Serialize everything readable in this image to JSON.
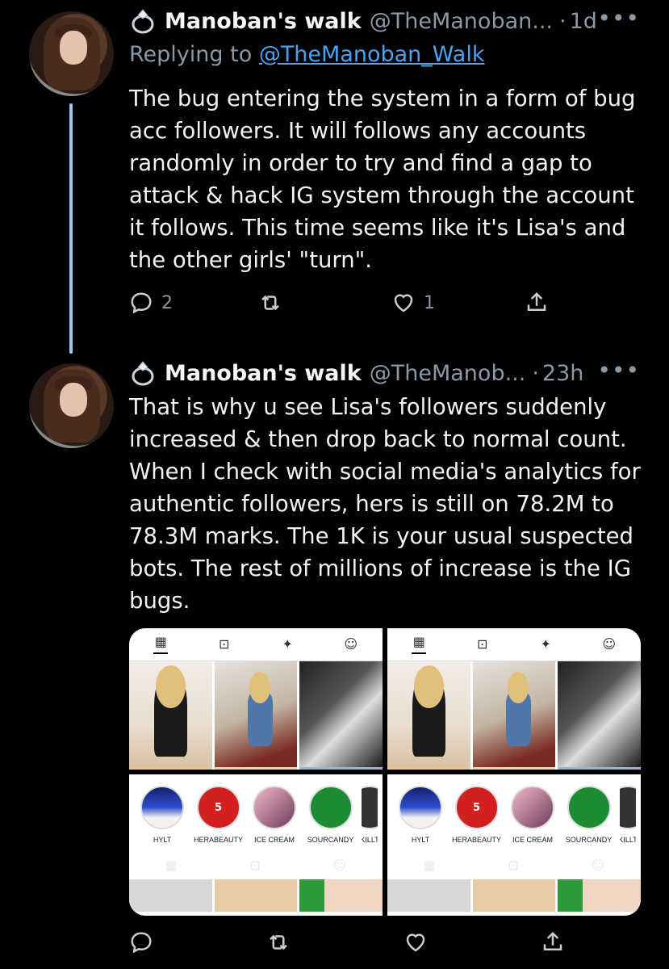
{
  "tweet1": {
    "display_name": "Manoban's walk",
    "handle": "@TheManoban...",
    "separator": "·",
    "time": "1d",
    "more": "•••",
    "replying_prefix": "Replying to",
    "replying_handle": "@TheManoban_Walk",
    "text": "The bug entering the system in a form of bug acc followers. It will follows any accounts randomly in order to try and find a gap to attack & hack IG system through the account it follows. This time seems like it's Lisa's and the other girls' \"turn\".",
    "reply_count": "2",
    "retweet_count": "",
    "like_count": "1"
  },
  "tweet2": {
    "display_name": "Manoban's walk",
    "handle": "@TheManob...",
    "separator": "·",
    "time": "23h",
    "more": "•••",
    "text": "That is why u see Lisa's followers suddenly increased & then drop back to normal count. When I check with social media's analytics for authentic followers, hers is still on 78.2M to 78.3M marks. The 1K is your usual suspected bots. The rest of millions of increase is the IG bugs."
  },
  "media": {
    "stories": [
      {
        "label": "HYLT",
        "badge": ""
      },
      {
        "label": "HERABEAUTY",
        "badge": "5"
      },
      {
        "label": "ICE CREAM",
        "badge": ""
      },
      {
        "label": "SOURCANDY",
        "badge": ""
      },
      {
        "label": "KILLT",
        "badge": ""
      }
    ]
  },
  "colors": {
    "background": "#000000",
    "text": "#e7e9ea",
    "muted": "#8b98a5",
    "link": "#4aa3f0",
    "thread_line": "#9ec5ee"
  },
  "icons": [
    "ring-icon",
    "reply-icon",
    "retweet-icon",
    "like-icon",
    "share-icon",
    "grid-icon",
    "reels-icon",
    "sparkle-icon",
    "tagged-icon"
  ]
}
